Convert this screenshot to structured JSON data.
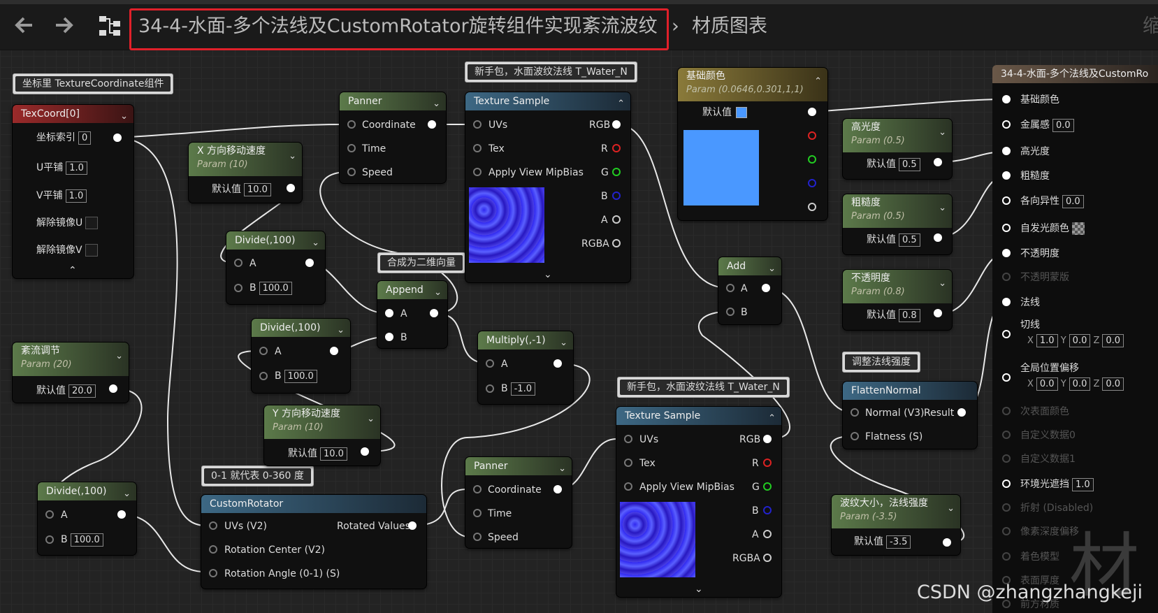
{
  "toolbar": {
    "back_icon": "arrow-left-icon",
    "forward_icon": "arrow-right-icon",
    "graph_icon": "node-graph-icon",
    "breadcrumb_title": "34-4-水面-多个法线及CustomRotator旋转组件实现紊流波纹",
    "breadcrumb_sep": "›",
    "breadcrumb_last": "材质图表",
    "right_text": "缩"
  },
  "comments": {
    "texcoord": "坐标里 TextureCoordinate组件",
    "water1": "新手包，水面波纹法线 T_Water_N",
    "append": "合成为二维向量",
    "flatten": "调整法线强度",
    "water2": "新手包，水面波纹法线 T_Water_N",
    "rotator": "0-1 就代表 0-360 度"
  },
  "texcoord": {
    "title": "TexCoord[0]",
    "index_label": "坐标索引",
    "index_value": "0",
    "u_label": "U平铺",
    "u_value": "1.0",
    "v_label": "V平铺",
    "v_value": "1.0",
    "mirror_u": "解除镜像U",
    "mirror_v": "解除镜像V"
  },
  "panner1": {
    "title": "Panner",
    "coord": "Coordinate",
    "time": "Time",
    "speed": "Speed"
  },
  "xspeed": {
    "title": "X 方向移动速度",
    "sub": "Param (10)",
    "default_label": "默认值",
    "value": "10.0"
  },
  "divide1": {
    "title": "Divide(,100)",
    "a": "A",
    "b": "B",
    "b_value": "100.0"
  },
  "divide2": {
    "title": "Divide(,100)",
    "a": "A",
    "b": "B",
    "b_value": "100.0"
  },
  "divide3": {
    "title": "Divide(,100)",
    "a": "A",
    "b": "B",
    "b_value": "100.0"
  },
  "turb": {
    "title": "紊流调节",
    "sub": "Param (20)",
    "default_label": "默认值",
    "value": "20.0"
  },
  "yspeed": {
    "title": "Y 方向移动速度",
    "sub": "Param (10)",
    "default_label": "默认值",
    "value": "10.0"
  },
  "append": {
    "title": "Append",
    "a": "A",
    "b": "B"
  },
  "multiply": {
    "title": "Multiply(,-1)",
    "a": "A",
    "b": "B",
    "b_value": "-1.0"
  },
  "tex1": {
    "title": "Texture Sample",
    "uvs": "UVs",
    "tex": "Tex",
    "mip": "Apply View MipBias",
    "rgb": "RGB",
    "r": "R",
    "g": "G",
    "b": "B",
    "a": "A",
    "rgba": "RGBA"
  },
  "tex2": {
    "title": "Texture Sample",
    "uvs": "UVs",
    "tex": "Tex",
    "mip": "Apply View MipBias",
    "rgb": "RGB",
    "r": "R",
    "g": "G",
    "b": "B",
    "a": "A",
    "rgba": "RGBA"
  },
  "basecolor": {
    "title": "基础颜色",
    "sub": "Param (0.0646,0.301,1,1)",
    "default_label": "默认值",
    "color": "#4a98ff"
  },
  "specular": {
    "title": "高光度",
    "sub": "Param (0.5)",
    "default_label": "默认值",
    "value": "0.5"
  },
  "roughness": {
    "title": "粗糙度",
    "sub": "Param (0.5)",
    "default_label": "默认值",
    "value": "0.5"
  },
  "opacity": {
    "title": "不透明度",
    "sub": "Param (0.8)",
    "default_label": "默认值",
    "value": "0.8"
  },
  "add": {
    "title": "Add",
    "a": "A",
    "b": "B"
  },
  "flatten": {
    "title": "FlattenNormal",
    "normal": "Normal (V3)",
    "result": "Result",
    "flatness": "Flatness (S)"
  },
  "wave": {
    "title": "波纹大小，法线强度",
    "sub": "Param (-3.5)",
    "default_label": "默认值",
    "value": "-3.5"
  },
  "panner2": {
    "title": "Panner",
    "coord": "Coordinate",
    "time": "Time",
    "speed": "Speed"
  },
  "rotator": {
    "title": "CustomRotator",
    "uvs": "UVs (V2)",
    "rotated": "Rotated Values",
    "center": "Rotation Center (V2)",
    "angle": "Rotation Angle (0-1) (S)"
  },
  "result": {
    "title": "34-4-水面-多个法线及CustomRo",
    "base_color": "基础颜色",
    "metallic": "金属感",
    "metallic_value": "0.0",
    "specular": "高光度",
    "roughness": "粗糙度",
    "anisotropy": "各向异性",
    "anisotropy_value": "0.0",
    "emissive": "自发光颜色",
    "opacity": "不透明度",
    "opacity_mask": "不透明蒙版",
    "normal": "法线",
    "tangent": "切线",
    "tangent_x": "1.0",
    "tangent_y": "0.0",
    "tangent_z": "0.0",
    "wpo": "全局位置偏移",
    "wpo_x": "0.0",
    "wpo_y": "0.0",
    "wpo_z": "0.0",
    "subsurface": "次表面颜色",
    "custom0": "自定义数据0",
    "custom1": "自定义数据1",
    "ao": "环境光遮挡",
    "ao_value": "1.0",
    "refraction": "折射 (Disabled)",
    "pixel_depth": "像素深度偏移",
    "shading_model": "着色模型",
    "surface_thickness": "表面厚度",
    "front_material": "前方材质"
  },
  "watermark": "CSDN @zhangzhangkeji",
  "bg_glyph": "材"
}
